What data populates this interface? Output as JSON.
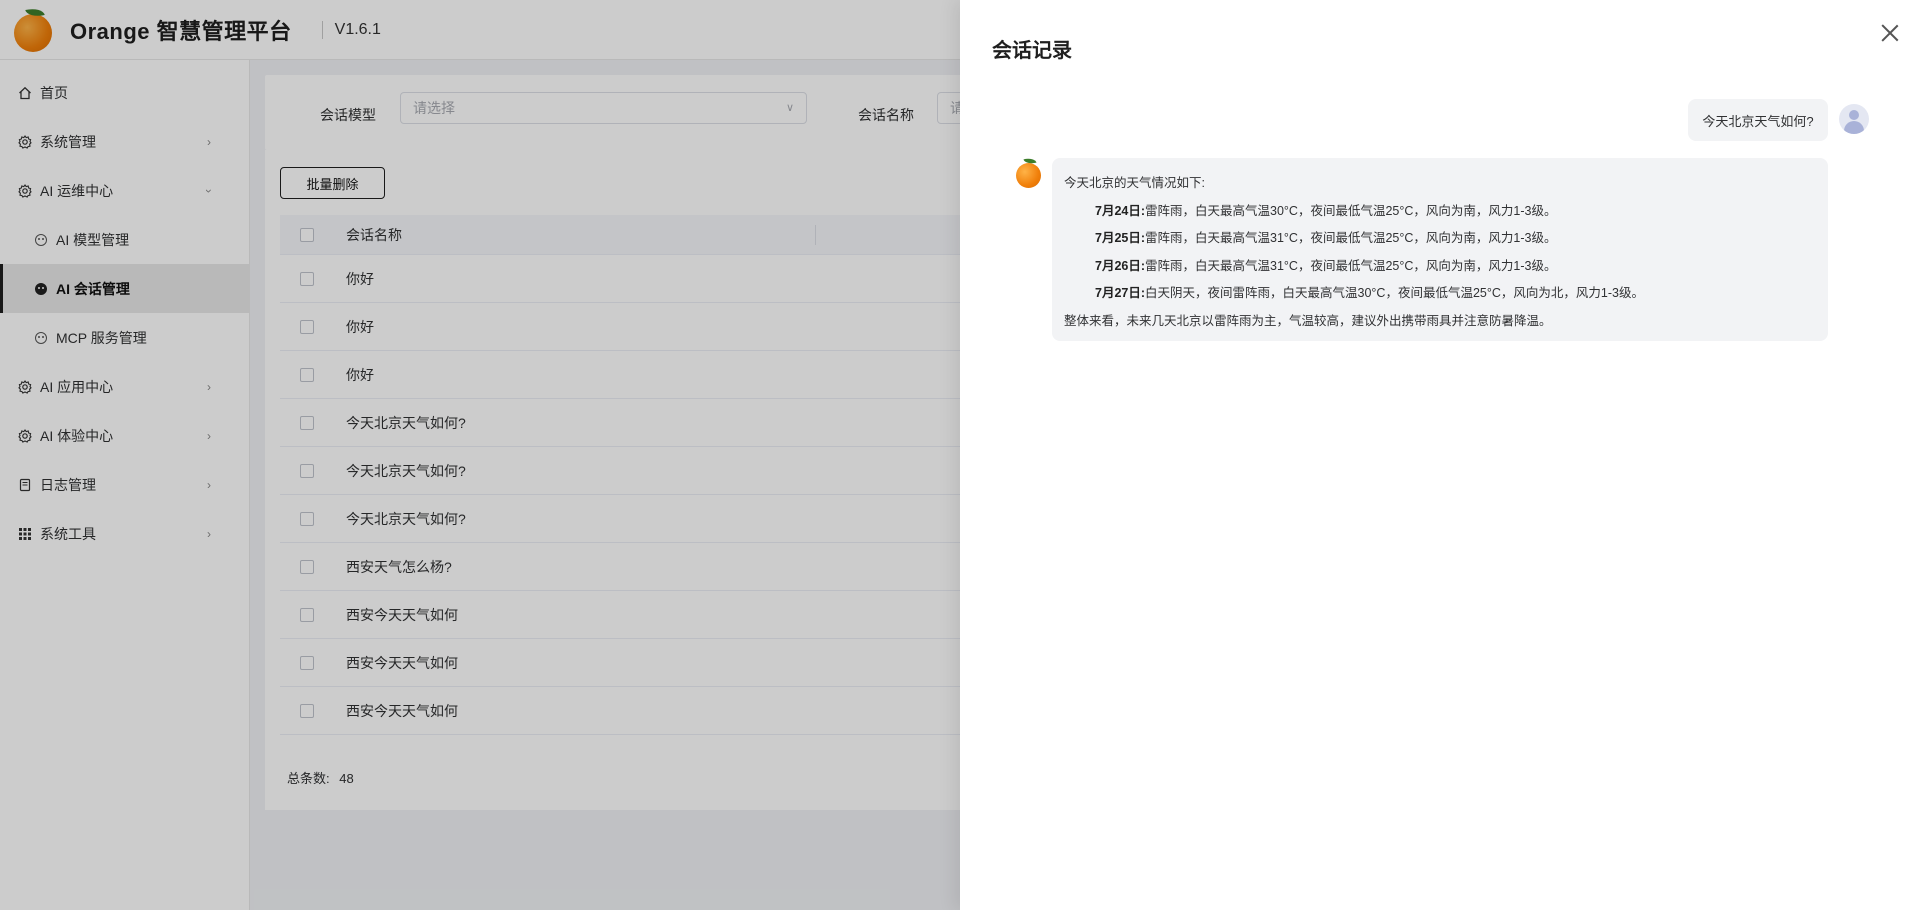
{
  "header": {
    "app_title": "Orange 智慧管理平台",
    "version": "V1.6.1"
  },
  "sidebar": {
    "items": [
      {
        "label": "首页",
        "icon": "home-icon"
      },
      {
        "label": "系统管理",
        "icon": "gear-icon"
      },
      {
        "label": "AI 运维中心",
        "icon": "gear-icon",
        "expanded": true,
        "children": [
          {
            "label": "AI 模型管理",
            "icon": "robot-icon"
          },
          {
            "label": "AI 会话管理",
            "icon": "robot-icon",
            "active": true
          },
          {
            "label": "MCP 服务管理",
            "icon": "robot-icon"
          }
        ]
      },
      {
        "label": "AI 应用中心",
        "icon": "gear-icon"
      },
      {
        "label": "AI 体验中心",
        "icon": "gear-icon"
      },
      {
        "label": "日志管理",
        "icon": "document-icon"
      },
      {
        "label": "系统工具",
        "icon": "grid-icon"
      }
    ]
  },
  "filters": {
    "model_label": "会话模型",
    "model_placeholder": "请选择",
    "name_label": "会话名称",
    "name_placeholder": "请"
  },
  "table": {
    "batch_delete_label": "批量删除",
    "column_name": "会话名称",
    "rows": [
      "你好",
      "你好",
      "你好",
      "今天北京天气如何?",
      "今天北京天气如何?",
      "今天北京天气如何?",
      "西安天气怎么杨?",
      "西安今天天气如何",
      "西安今天天气如何",
      "西安今天天气如何"
    ],
    "total_label": "总条数:",
    "total_value": "48"
  },
  "drawer": {
    "title": "会话记录",
    "user_message": "今天北京天气如何?",
    "bot_intro": "今天北京的天气情况如下:",
    "bot_days": [
      {
        "date": "7月24日:",
        "text": "雷阵雨，白天最高气温30°C，夜间最低气温25°C，风向为南，风力1-3级。"
      },
      {
        "date": "7月25日:",
        "text": "雷阵雨，白天最高气温31°C，夜间最低气温25°C，风向为南，风力1-3级。"
      },
      {
        "date": "7月26日:",
        "text": "雷阵雨，白天最高气温31°C，夜间最低气温25°C，风向为南，风力1-3级。"
      },
      {
        "date": "7月27日:",
        "text": "白天阴天，夜间雷阵雨，白天最高气温30°C，夜间最低气温25°C，风向为北，风力1-3级。"
      }
    ],
    "bot_summary": "整体来看，未来几天北京以雷阵雨为主，气温较高，建议外出携带雨具并注意防暑降温。"
  }
}
